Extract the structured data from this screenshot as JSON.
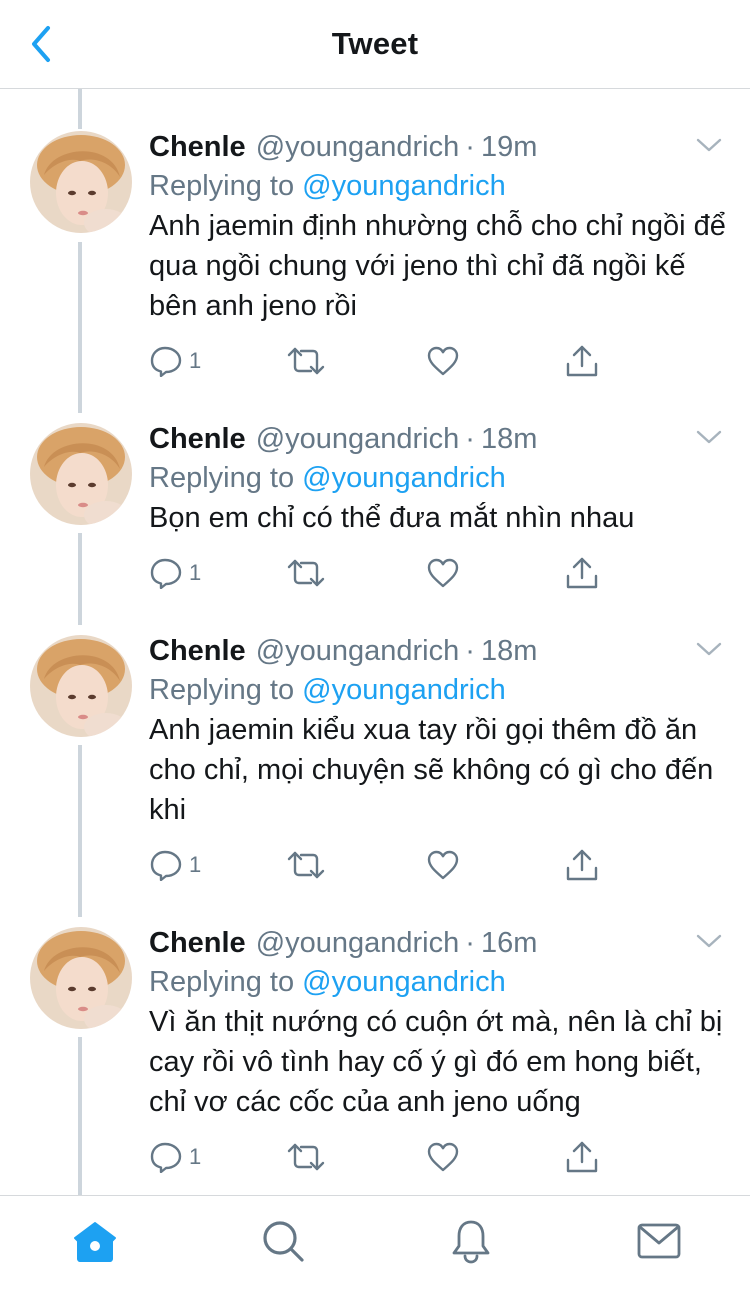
{
  "header": {
    "title": "Tweet",
    "back_icon": "chevron-left-icon"
  },
  "colors": {
    "accent": "#1da1f2",
    "text": "#14171a",
    "secondary": "#657786",
    "thread_line": "#cdd5dc"
  },
  "tweets": [
    {
      "name": "Chenle",
      "handle": "@youngandrich",
      "separator": "·",
      "time": "19m",
      "replying_prefix": "Replying to",
      "replying_handle": "@youngandrich",
      "text": "Anh jaemin định nhường chỗ cho chỉ ngồi để qua ngồi chung với jeno thì chỉ đã ngồi kế bên anh jeno rồi",
      "reply_count": "1"
    },
    {
      "name": "Chenle",
      "handle": "@youngandrich",
      "separator": "·",
      "time": "18m",
      "replying_prefix": "Replying to",
      "replying_handle": "@youngandrich",
      "text": "Bọn em chỉ có thể đưa mắt nhìn nhau",
      "reply_count": "1"
    },
    {
      "name": "Chenle",
      "handle": "@youngandrich",
      "separator": "·",
      "time": "18m",
      "replying_prefix": "Replying to",
      "replying_handle": "@youngandrich",
      "text": "Anh jaemin kiểu xua tay rồi gọi thêm đồ ăn cho chỉ, mọi chuyện sẽ không có gì cho đến khi",
      "reply_count": "1"
    },
    {
      "name": "Chenle",
      "handle": "@youngandrich",
      "separator": "·",
      "time": "16m",
      "replying_prefix": "Replying to",
      "replying_handle": "@youngandrich",
      "text": "Vì ăn thịt nướng có cuộn ớt mà, nên là chỉ bị cay rồi vô tình hay cố ý gì đó em hong biết, chỉ vơ các cốc của anh jeno uống",
      "reply_count": "1"
    }
  ],
  "tabbar": {
    "items": [
      "home-icon",
      "search-icon",
      "notifications-bell-icon",
      "messages-envelope-icon"
    ],
    "active": "home-icon"
  }
}
